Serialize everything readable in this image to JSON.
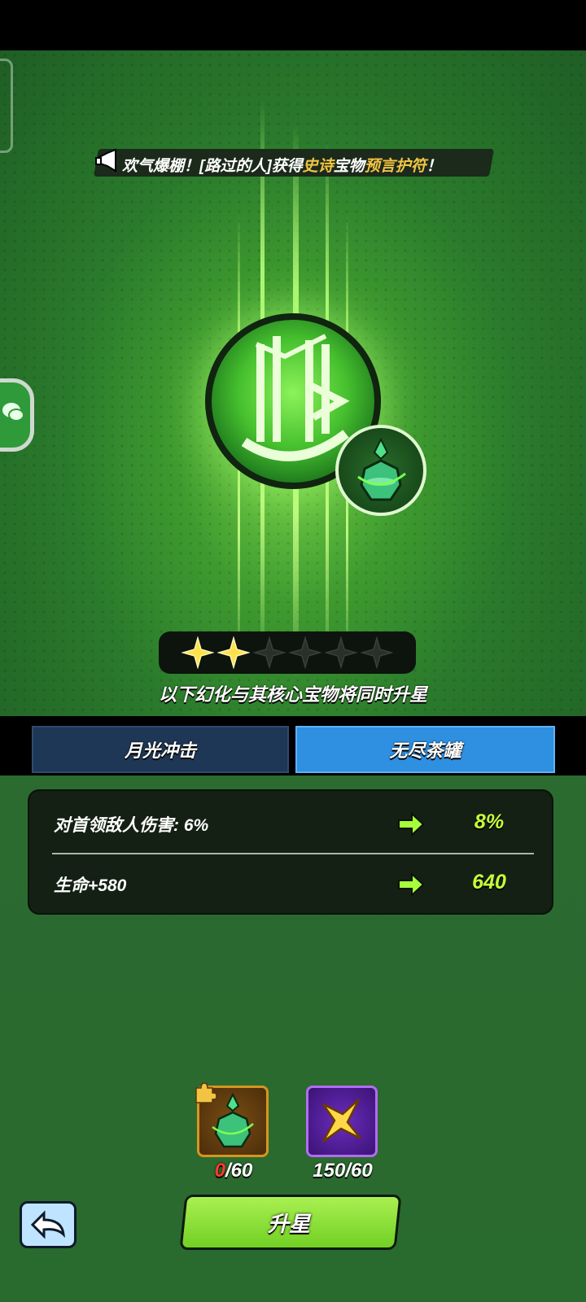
{
  "announcement": {
    "prefix": "欢气爆棚！[路过的人]获得",
    "rarity": "史诗",
    "middle": "宝物",
    "item": "预言护符",
    "suffix": "！"
  },
  "stars": {
    "filled": 2,
    "total": 6
  },
  "caption": "以下幻化与其核心宝物将同时升星",
  "tabs": [
    {
      "label": "月光冲击",
      "active": false
    },
    {
      "label": "无尽茶罐",
      "active": true
    }
  ],
  "stats": [
    {
      "label": "对首领敌人伤害: 6%",
      "next": "8%"
    },
    {
      "label": "生命+580",
      "next": "640"
    }
  ],
  "materials": [
    {
      "icon": "jade-jar-shard-icon",
      "have": "0",
      "need": "/60"
    },
    {
      "icon": "gold-star-icon",
      "have": "150",
      "need": "/60"
    }
  ],
  "buttons": {
    "upgrade": "升星"
  },
  "colors": {
    "accent_green": "#c6ff3a",
    "tab_active": "#2f8fe0",
    "tab_inactive": "#1f3756",
    "rarity_gold": "#f3c443",
    "insufficient_red": "#ff3b2e"
  }
}
